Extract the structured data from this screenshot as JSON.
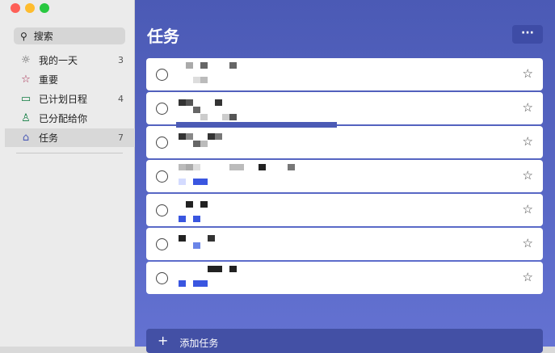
{
  "window": {
    "controls": [
      "close",
      "minimize",
      "zoom"
    ],
    "colors": {
      "close": "#fe5f57",
      "minimize": "#febc2e",
      "zoom": "#28c840"
    }
  },
  "sidebar": {
    "search_label": "搜索",
    "items": [
      {
        "label": "我的一天",
        "count": "3",
        "icon": "sun-icon",
        "color": "#555555"
      },
      {
        "label": "重要",
        "count": "",
        "icon": "star-icon",
        "color": "#a4264b"
      },
      {
        "label": "已计划日程",
        "count": "4",
        "icon": "calendar-icon",
        "color": "#107c41"
      },
      {
        "label": "已分配给你",
        "count": "",
        "icon": "person-icon",
        "color": "#107c41"
      },
      {
        "label": "任务",
        "count": "7",
        "icon": "home-icon",
        "color": "#4b5ab5"
      }
    ]
  },
  "main": {
    "title": "任务",
    "more_label": "···",
    "task_count": 7,
    "add_task_label": "添加任务",
    "accent": "#4b5ab5"
  }
}
